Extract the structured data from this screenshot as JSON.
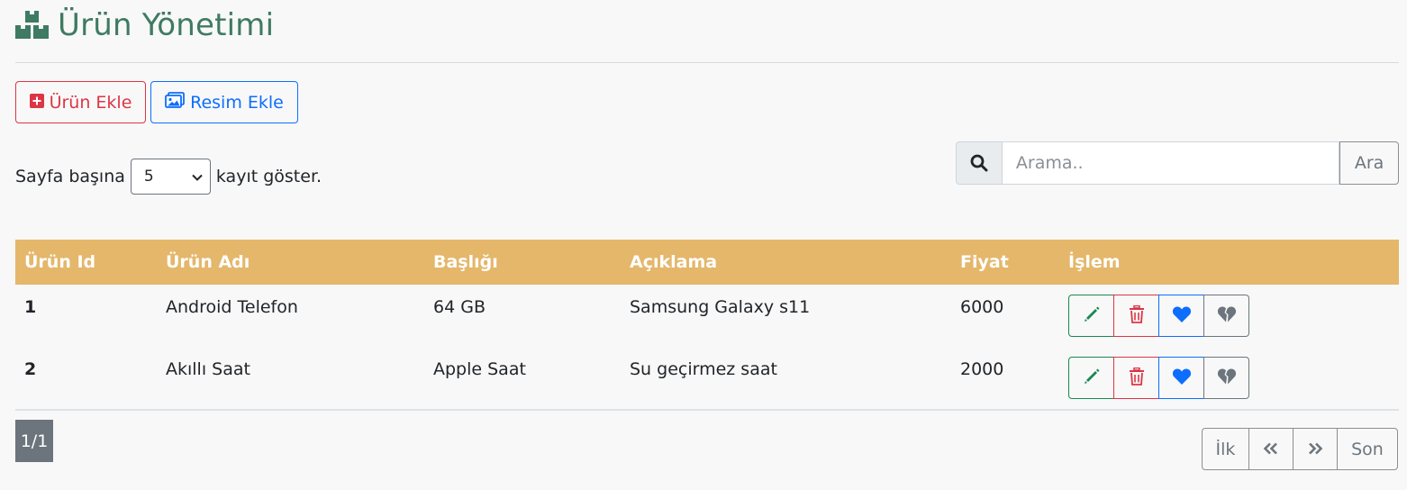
{
  "header": {
    "title": "Ürün Yönetimi",
    "icon": "boxes-icon"
  },
  "toolbar": {
    "add_product_label": "Ürün Ekle",
    "add_image_label": "Resim Ekle"
  },
  "paging_size": {
    "prefix": "Sayfa başına",
    "selected": "5",
    "suffix": "kayıt göster."
  },
  "search": {
    "placeholder": "Arama..",
    "button_label": "Ara"
  },
  "table": {
    "columns": [
      "Ürün Id",
      "Ürün Adı",
      "Başlığı",
      "Açıklama",
      "Fiyat",
      "İşlem"
    ],
    "rows": [
      {
        "id": "1",
        "name": "Android Telefon",
        "title": "64 GB",
        "description": "Samsung Galaxy s11",
        "price": "6000"
      },
      {
        "id": "2",
        "name": "Akıllı Saat",
        "title": "Apple Saat",
        "description": "Su geçirmez saat",
        "price": "2000"
      }
    ]
  },
  "pagination": {
    "info": "1/1",
    "first": "İlk",
    "prev": "«",
    "next": "»",
    "last": "Son"
  },
  "colors": {
    "title": "#3f7a63",
    "table_header": "#e4b76b",
    "danger": "#dc3545",
    "primary": "#0d6efd",
    "success": "#198754",
    "secondary": "#6c757d"
  }
}
